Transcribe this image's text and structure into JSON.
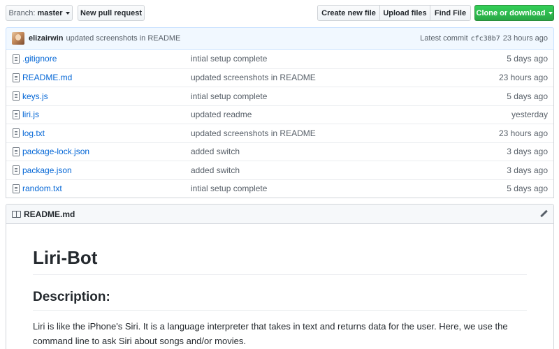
{
  "toolbar": {
    "branch_prefix": "Branch:",
    "branch_name": "master",
    "new_pull_request": "New pull request",
    "create_new_file": "Create new file",
    "upload_files": "Upload files",
    "find_file": "Find File",
    "clone_or_download": "Clone or download"
  },
  "commit": {
    "author": "elizairwin",
    "message": "updated screenshots in README",
    "latest_label": "Latest commit",
    "sha": "cfc38b7",
    "age": "23 hours ago"
  },
  "files": [
    {
      "name": ".gitignore",
      "message": "intial setup complete",
      "age": "5 days ago"
    },
    {
      "name": "README.md",
      "message": "updated screenshots in README",
      "age": "23 hours ago"
    },
    {
      "name": "keys.js",
      "message": "intial setup complete",
      "age": "5 days ago"
    },
    {
      "name": "liri.js",
      "message": "updated readme",
      "age": "yesterday"
    },
    {
      "name": "log.txt",
      "message": "updated screenshots in README",
      "age": "23 hours ago"
    },
    {
      "name": "package-lock.json",
      "message": "added switch",
      "age": "3 days ago"
    },
    {
      "name": "package.json",
      "message": "added switch",
      "age": "3 days ago"
    },
    {
      "name": "random.txt",
      "message": "intial setup complete",
      "age": "5 days ago"
    }
  ],
  "readme": {
    "filename": "README.md",
    "title": "Liri-Bot",
    "section_heading": "Description:",
    "description": "Liri is like the iPhone's Siri. It is a language interpreter that takes in text and returns data for the user. Here, we use the command line to ask Siri about songs and/or movies."
  },
  "colors": {
    "link": "#0366d6",
    "green_button": "#28a745",
    "commit_bar": "#f1f8ff"
  }
}
